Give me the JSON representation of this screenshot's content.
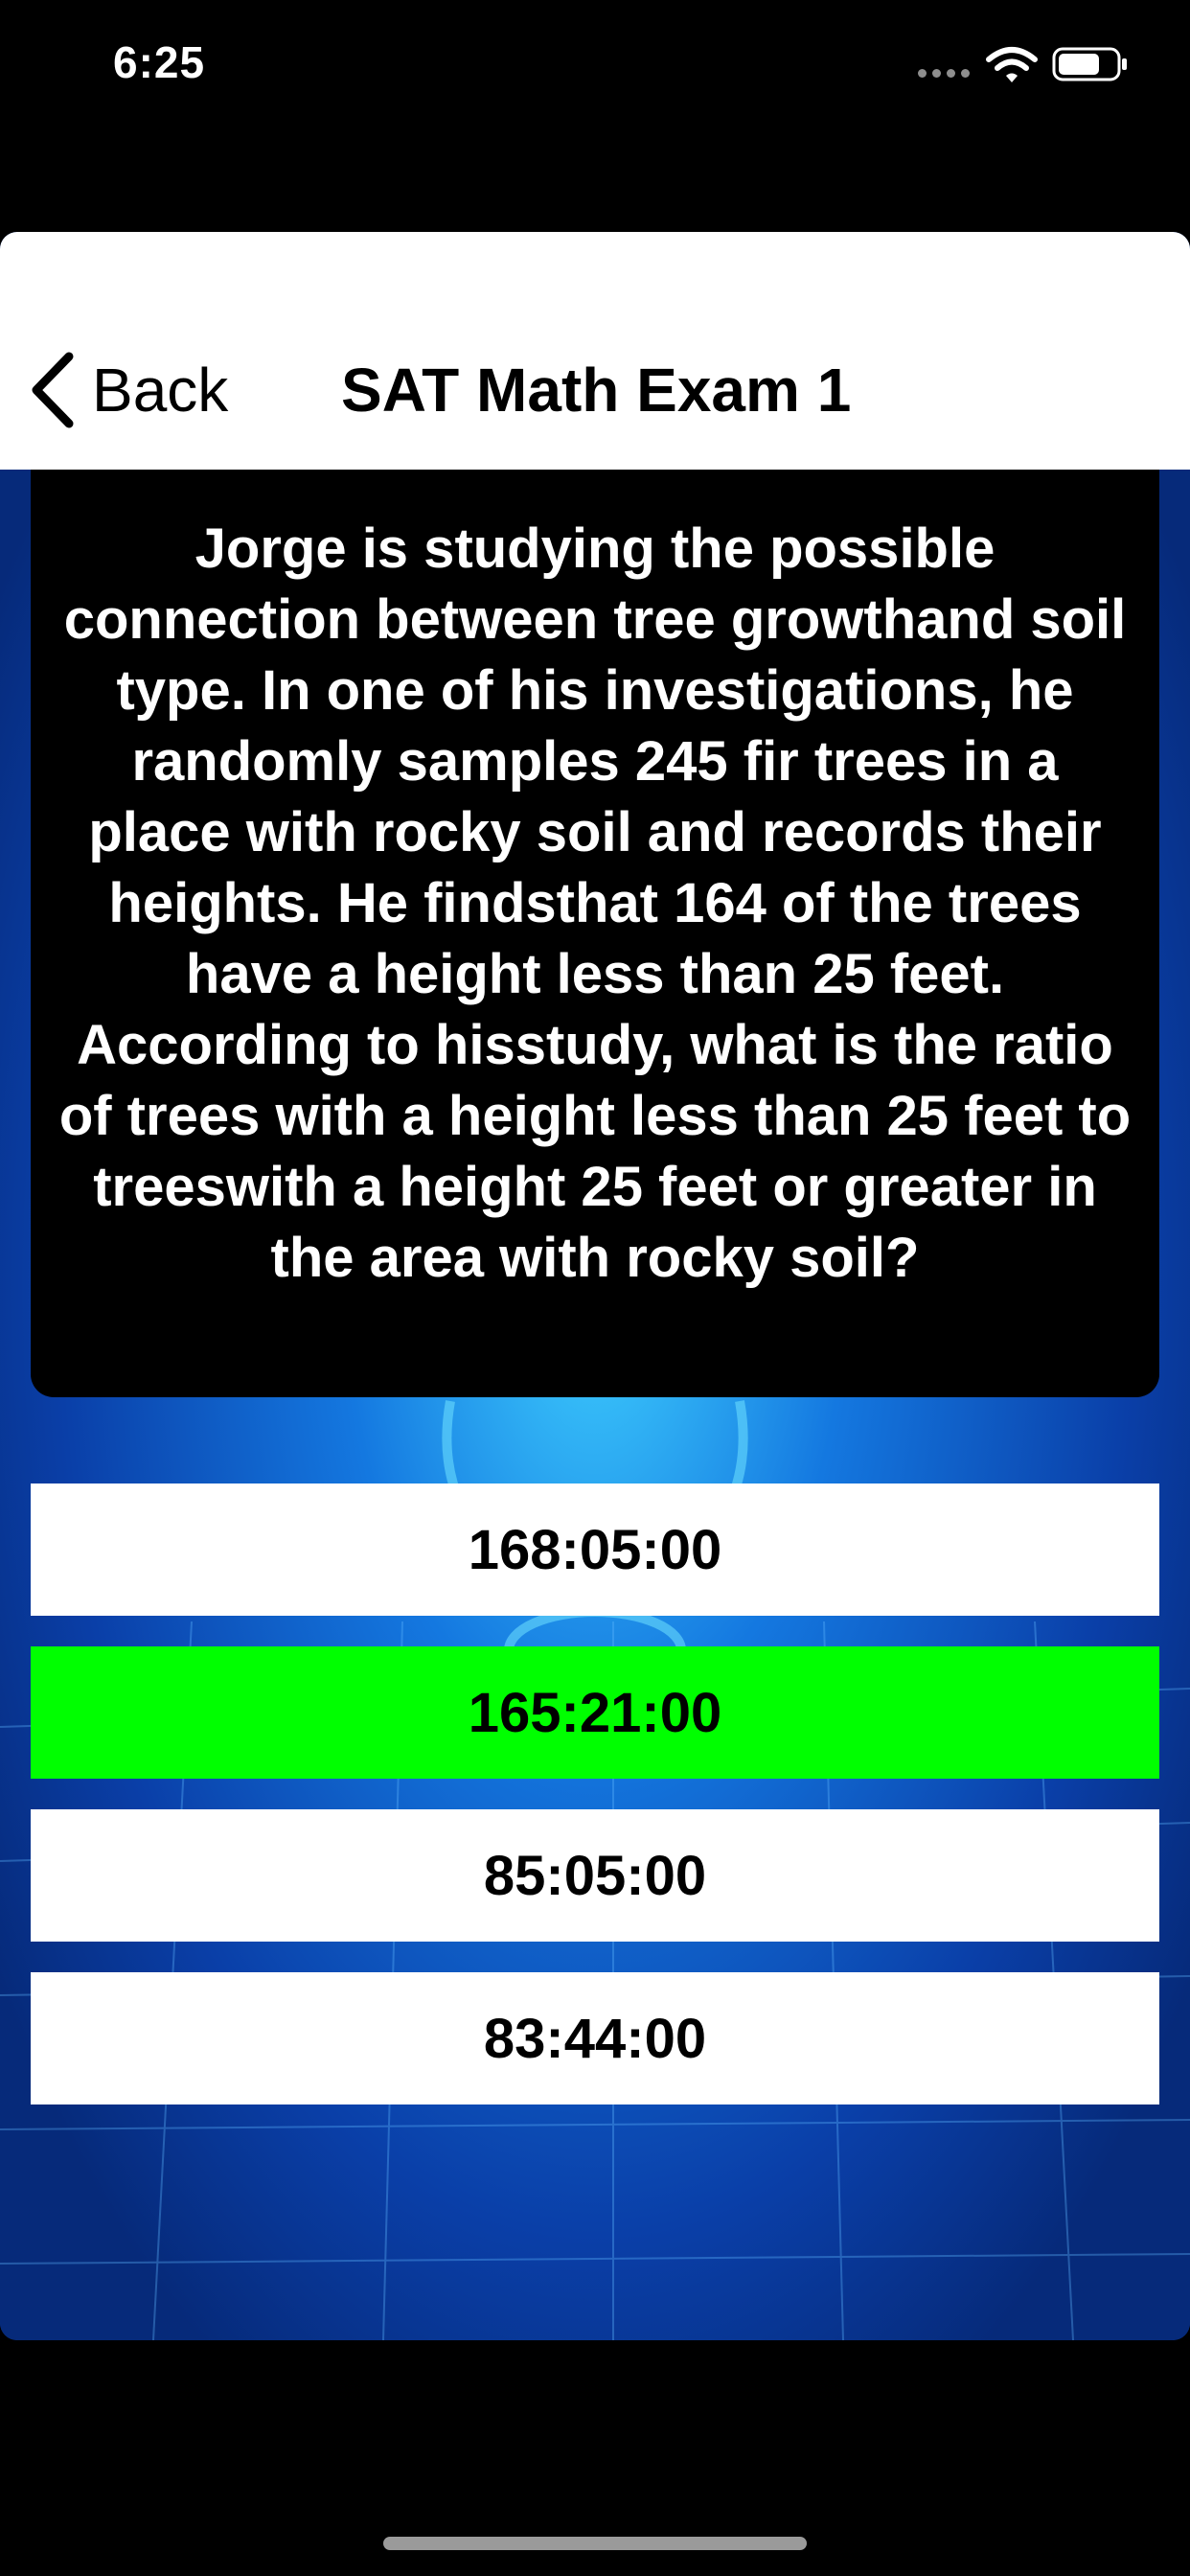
{
  "status_bar": {
    "time": "6:25",
    "icons": [
      "signal-dots-icon",
      "wifi-icon",
      "battery-icon"
    ]
  },
  "nav": {
    "back_label": "Back",
    "title": "SAT Math Exam 1"
  },
  "question": {
    "text": "Jorge is studying the possible connection between tree growthand soil type. In one of his investigations, he randomly samples 245 fir trees in a place with rocky soil and records their heights. He findsthat 164 of the trees have a height less than 25 feet. According to hisstudy, what is the ratio of trees with a height less than 25 feet to treeswith a height 25 feet or greater in the area with rocky soil?"
  },
  "answers": [
    {
      "label": "168:05:00",
      "state": "default"
    },
    {
      "label": "165:21:00",
      "state": "correct"
    },
    {
      "label": "85:05:00",
      "state": "default"
    },
    {
      "label": "83:44:00",
      "state": "default"
    }
  ],
  "colors": {
    "correct": "#00ff00",
    "option_background": "#ffffff",
    "question_background": "#000000",
    "app_background": "#0a3fa8"
  }
}
